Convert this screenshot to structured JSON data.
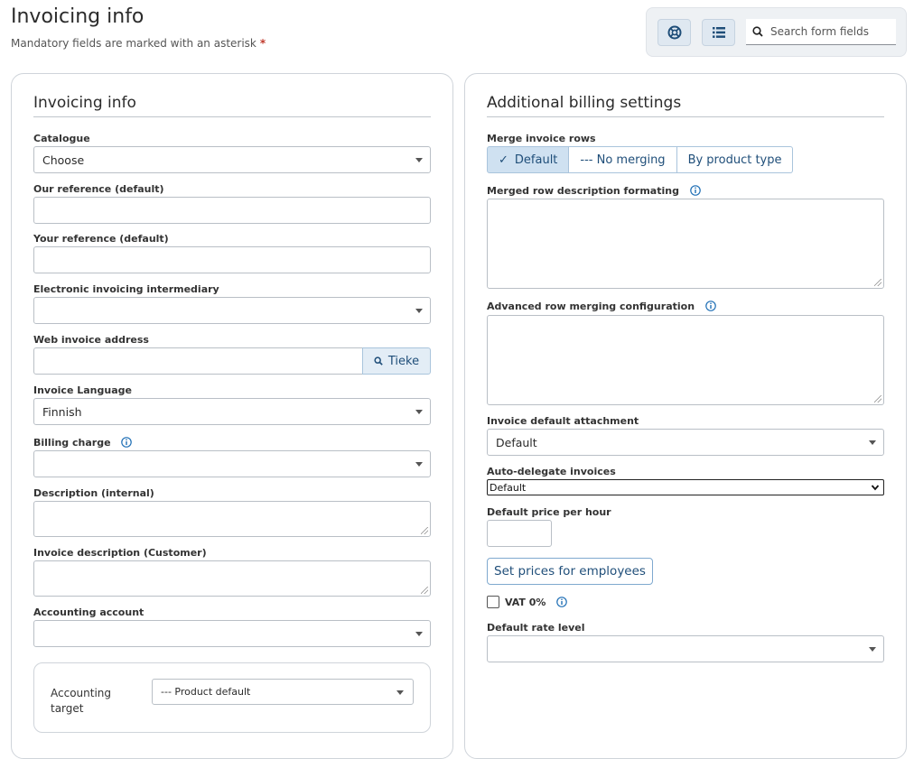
{
  "page": {
    "title": "Invoicing info",
    "subtitle": "Mandatory fields are marked with an asterisk",
    "required_marker": "*"
  },
  "toolbar": {
    "help_icon": "lifebuoy-icon",
    "list_icon": "list-icon",
    "search_placeholder": "Search form fields",
    "search_value": ""
  },
  "left_panel": {
    "title": "Invoicing info",
    "fields": {
      "catalogue": {
        "label": "Catalogue",
        "value": "Choose"
      },
      "our_reference": {
        "label": "Our reference (default)",
        "value": ""
      },
      "your_reference": {
        "label": "Your reference (default)",
        "value": ""
      },
      "einvoicing_intermediary": {
        "label": "Electronic invoicing intermediary",
        "value": ""
      },
      "web_invoice_address": {
        "label": "Web invoice address",
        "value": "",
        "button_label": "Tieke"
      },
      "invoice_language": {
        "label": "Invoice Language",
        "value": "Finnish"
      },
      "billing_charge": {
        "label": "Billing charge",
        "value": ""
      },
      "description_internal": {
        "label": "Description (internal)",
        "value": ""
      },
      "invoice_description_customer": {
        "label": "Invoice description (Customer)",
        "value": ""
      },
      "accounting_account": {
        "label": "Accounting account",
        "value": ""
      },
      "accounting_target": {
        "label": "Accounting target",
        "value": "--- Product default"
      }
    }
  },
  "right_panel": {
    "title": "Additional billing settings",
    "merge_invoice_rows": {
      "label": "Merge invoice rows",
      "options": [
        "Default",
        "--- No merging",
        "By product type"
      ],
      "selected": "Default",
      "check_mark": "✓"
    },
    "merged_row_description": {
      "label": "Merged row description formating",
      "value": ""
    },
    "advanced_row_merging": {
      "label": "Advanced row merging configuration",
      "value": ""
    },
    "invoice_default_attachment": {
      "label": "Invoice default attachment",
      "value": "Default"
    },
    "auto_delegate": {
      "label": "Auto-delegate invoices",
      "value": "Default"
    },
    "default_price_per_hour": {
      "label": "Default price per hour",
      "value": ""
    },
    "set_prices_button": "Set prices for employees",
    "vat_zero": {
      "label": "VAT 0%",
      "checked": false
    },
    "default_rate_level": {
      "label": "Default rate level",
      "value": ""
    }
  },
  "colors": {
    "accent": "#1f4e79",
    "active_segment": "#cfe1f1",
    "required": "#c0392b"
  }
}
